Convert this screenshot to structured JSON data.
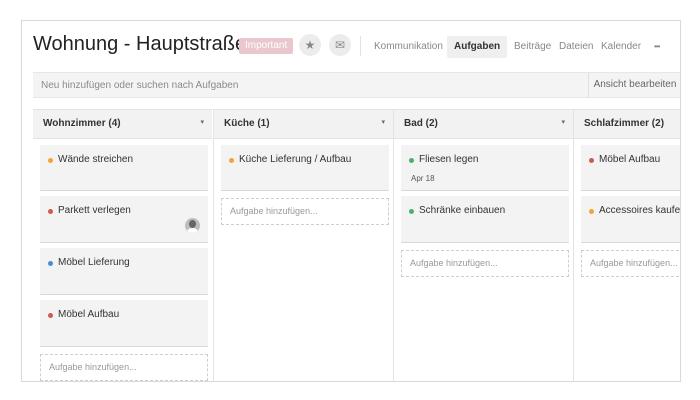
{
  "header": {
    "title": "Wohnung - Hauptstraße ...",
    "badge": "Important",
    "star_icon": "★",
    "mail_icon": "✉",
    "tabs": [
      {
        "label": "Kommunikation",
        "active": false
      },
      {
        "label": "Aufgaben",
        "active": true
      },
      {
        "label": "Beiträge",
        "active": false
      },
      {
        "label": "Dateien",
        "active": false
      },
      {
        "label": "Kalender",
        "active": false
      }
    ],
    "more_icon": "•••"
  },
  "search": {
    "placeholder": "Neu hinzufügen oder suchen nach Aufgaben",
    "edit_view_label": "Ansicht bearbeiten"
  },
  "colors": {
    "orange": "#f0a43a",
    "red": "#cc5a53",
    "blue": "#4a8bd6",
    "green": "#4caf6e",
    "badge": "#e9c7cc"
  },
  "columns": [
    {
      "title": "Wohnzimmer (4)",
      "caret": "▾",
      "cards": [
        {
          "title": "Wände streichen",
          "dot": "orange"
        },
        {
          "title": "Parkett verlegen",
          "dot": "red",
          "avatar": true
        },
        {
          "title": "Möbel Lieferung",
          "dot": "blue"
        },
        {
          "title": "Möbel Aufbau",
          "dot": "red"
        }
      ],
      "add_label": "Aufgabe hinzufügen..."
    },
    {
      "title": "Küche (1)",
      "caret": "▾",
      "cards": [
        {
          "title": "Küche Lieferung / Aufbau",
          "dot": "orange"
        }
      ],
      "add_label": "Aufgabe hinzufügen..."
    },
    {
      "title": "Bad (2)",
      "caret": "▾",
      "cards": [
        {
          "title": "Fliesen legen",
          "dot": "green",
          "date": "Apr 18"
        },
        {
          "title": "Schränke einbauen",
          "dot": "green"
        }
      ],
      "add_label": "Aufgabe hinzufügen..."
    },
    {
      "title": "Schlafzimmer (2)",
      "caret": "▾",
      "cards": [
        {
          "title": "Möbel Aufbau",
          "dot": "red"
        },
        {
          "title": "Accessoires kaufen",
          "dot": "orange"
        }
      ],
      "add_label": "Aufgabe hinzufügen..."
    }
  ]
}
